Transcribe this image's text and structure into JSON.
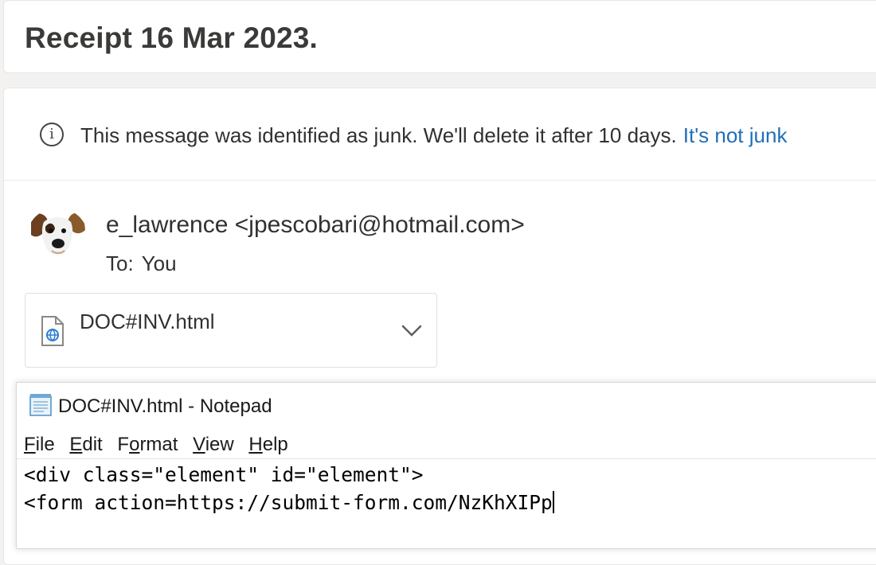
{
  "email": {
    "subject": "Receipt 16 Mar 2023.",
    "junk_notice": "This message was identified as junk. We'll delete it after 10 days.",
    "junk_action": "It's not junk",
    "sender": "e_lawrence <jpescobari@hotmail.com>",
    "to_label": "To:",
    "recipient": "You",
    "attachment": {
      "name": "DOC#INV.html",
      "icon": "html-file-icon"
    }
  },
  "notepad": {
    "title": "DOC#INV.html - Notepad",
    "menu": [
      {
        "accel": "F",
        "rest": "ile"
      },
      {
        "accel": "E",
        "rest": "dit"
      },
      {
        "pre": "F",
        "accel": "o",
        "rest": "rmat"
      },
      {
        "accel": "V",
        "rest": "iew"
      },
      {
        "accel": "H",
        "rest": "elp"
      }
    ],
    "lines": [
      "<div class=\"element\" id=\"element\">",
      "<form action=https://submit-form.com/NzKhXIPp"
    ]
  },
  "colors": {
    "link": "#1f6fb8",
    "background": "#f3f2f1"
  }
}
